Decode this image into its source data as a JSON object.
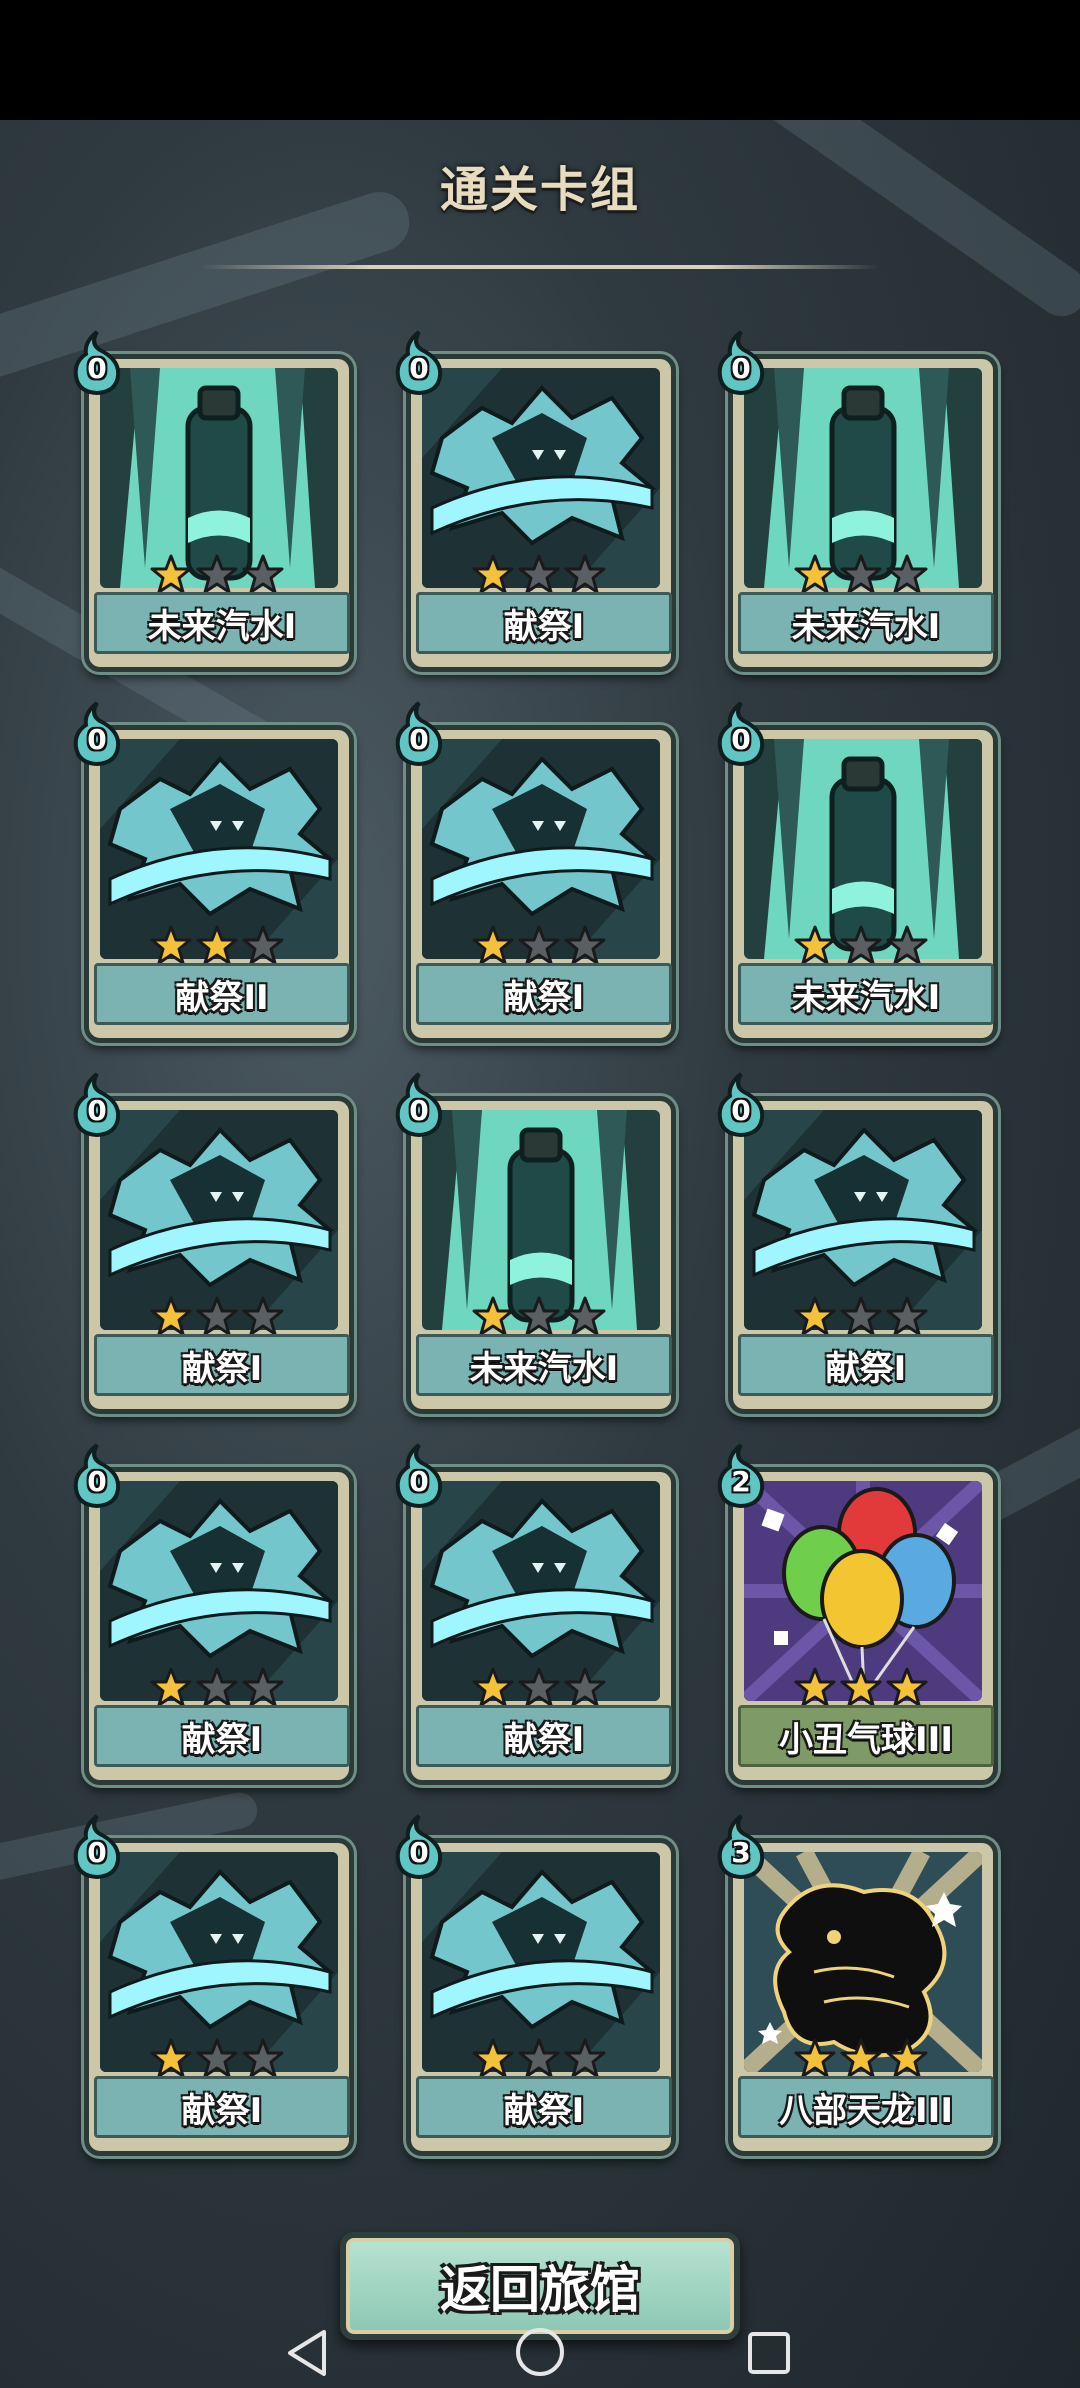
{
  "title": "通关卡组",
  "cards": [
    {
      "name": "未来汽水I",
      "cost": "0",
      "stars": 1,
      "art": "soda-bottle-art",
      "kind": "epic"
    },
    {
      "name": "献祭I",
      "cost": "0",
      "stars": 1,
      "art": "sacrifice-art",
      "kind": "epic"
    },
    {
      "name": "未来汽水I",
      "cost": "0",
      "stars": 1,
      "art": "soda-bottle-art",
      "kind": "epic"
    },
    {
      "name": "献祭II",
      "cost": "0",
      "stars": 2,
      "art": "sacrifice-art",
      "kind": "epic"
    },
    {
      "name": "献祭I",
      "cost": "0",
      "stars": 1,
      "art": "sacrifice-art",
      "kind": "epic"
    },
    {
      "name": "未来汽水I",
      "cost": "0",
      "stars": 1,
      "art": "soda-bottle-art",
      "kind": "epic"
    },
    {
      "name": "献祭I",
      "cost": "0",
      "stars": 1,
      "art": "sacrifice-art",
      "kind": "epic"
    },
    {
      "name": "未来汽水I",
      "cost": "0",
      "stars": 1,
      "art": "soda-bottle-art",
      "kind": "epic"
    },
    {
      "name": "献祭I",
      "cost": "0",
      "stars": 1,
      "art": "sacrifice-art",
      "kind": "epic"
    },
    {
      "name": "献祭I",
      "cost": "0",
      "stars": 1,
      "art": "sacrifice-art",
      "kind": "epic"
    },
    {
      "name": "献祭I",
      "cost": "0",
      "stars": 1,
      "art": "sacrifice-art",
      "kind": "epic"
    },
    {
      "name": "小丑气球III",
      "cost": "2",
      "stars": 3,
      "art": "balloons-art",
      "kind": "rare"
    },
    {
      "name": "献祭I",
      "cost": "0",
      "stars": 1,
      "art": "sacrifice-art",
      "kind": "epic"
    },
    {
      "name": "献祭I",
      "cost": "0",
      "stars": 1,
      "art": "sacrifice-art",
      "kind": "epic"
    },
    {
      "name": "八部天龙III",
      "cost": "3",
      "stars": 3,
      "art": "dragon-art",
      "kind": "epic"
    }
  ],
  "buttons": {
    "return_label": "返回旅馆"
  },
  "navbar": {
    "back": "back-icon",
    "home": "home-icon",
    "recents": "recents-icon"
  },
  "colors": {
    "star_on": "#f4c23a",
    "star_off": "#5a5f63",
    "namebar": "#7ab3b1",
    "title": "#e8dcc0"
  }
}
